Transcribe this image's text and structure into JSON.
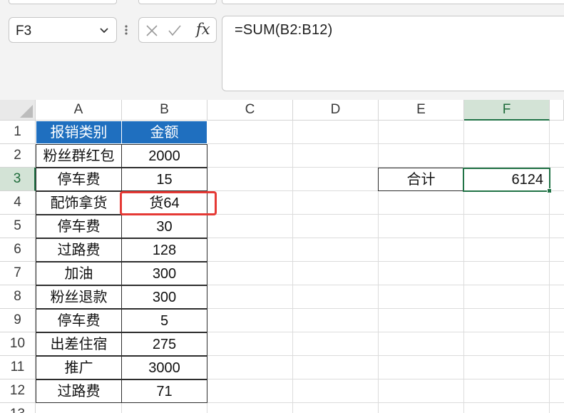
{
  "name_box": {
    "value": "F3"
  },
  "formula_bar": {
    "cancel_icon": "close-icon",
    "enter_icon": "check-icon",
    "fx_label": "fx",
    "formula": "=SUM(B2:B12)"
  },
  "columns": [
    "A",
    "B",
    "C",
    "D",
    "E",
    "F"
  ],
  "rows": [
    "1",
    "2",
    "3",
    "4",
    "5",
    "6",
    "7",
    "8",
    "9",
    "10",
    "11",
    "12",
    "13"
  ],
  "selected_column": "F",
  "selected_row": "3",
  "table": {
    "headers": [
      "报销类别",
      "金额"
    ],
    "rows": [
      [
        "粉丝群红包",
        "2000"
      ],
      [
        "停车费",
        "15"
      ],
      [
        "配饰拿货",
        "货64"
      ],
      [
        "停车费",
        "30"
      ],
      [
        "过路费",
        "128"
      ],
      [
        "加油",
        "300"
      ],
      [
        "粉丝退款",
        "300"
      ],
      [
        "停车费",
        "5"
      ],
      [
        "出差住宿",
        "275"
      ],
      [
        "推广",
        "3000"
      ],
      [
        "过路费",
        "71"
      ]
    ]
  },
  "summary": {
    "label": "合计",
    "value": "6124"
  },
  "colors": {
    "header_fill": "#1f6fbf",
    "selection_green": "#217346",
    "highlight_red": "#e53935"
  }
}
